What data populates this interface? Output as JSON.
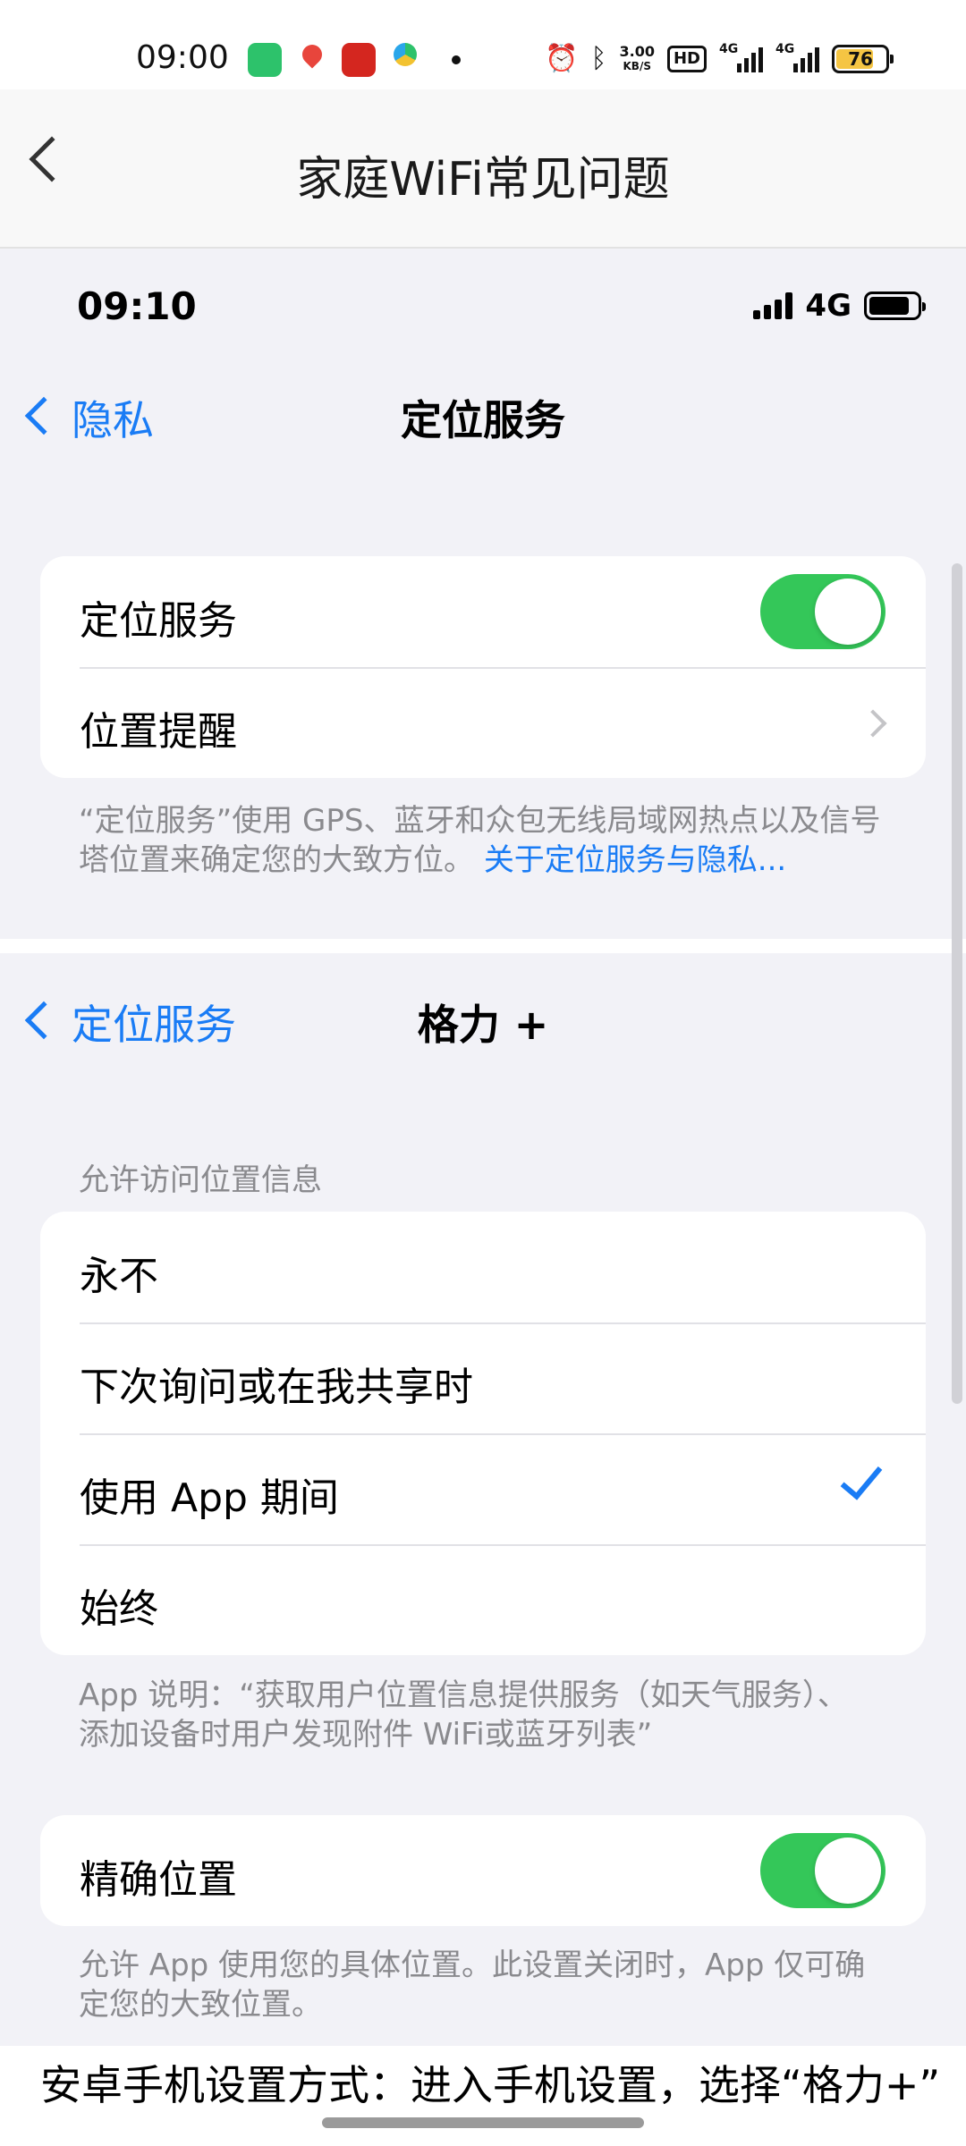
{
  "android_status": {
    "time": "09:00",
    "speed_value": "3.00",
    "speed_unit": "KB/S",
    "hd_label": "HD",
    "network_1": "4G",
    "network_2": "4G",
    "battery": "76"
  },
  "header": {
    "title": "家庭WiFi常见问题"
  },
  "ios_status": {
    "time": "09:10",
    "network": "4G"
  },
  "privacy_screen": {
    "back_label": "隐私",
    "title": "定位服务",
    "location_services_label": "定位服务",
    "location_services_on": true,
    "location_alerts_label": "位置提醒",
    "footnote_text": "“定位服务”使用 GPS、蓝牙和众包无线局域网热点以及信号塔位置来确定您的大致方位。",
    "footnote_link": "关于定位服务与隐私..."
  },
  "app_screen": {
    "back_label": "定位服务",
    "title": "格力 +",
    "section_header": "允许访问位置信息",
    "options": [
      {
        "label": "永不",
        "selected": false
      },
      {
        "label": "下次询问或在我共享时",
        "selected": false
      },
      {
        "label": "使用 App 期间",
        "selected": true
      },
      {
        "label": "始终",
        "selected": false
      }
    ],
    "app_explanation": "App 说明：“获取用户位置信息提供服务（如天气服务）、 添加设备时用户发现附件 WiFi或蓝牙列表”",
    "precise_location_label": "精确位置",
    "precise_location_on": true,
    "precise_footnote": "允许 App 使用您的具体位置。此设置关闭时，App 仅可确定您的大致位置。"
  },
  "caption": {
    "text": "安卓手机设置方式：进入手机设置，选择“格力+”"
  },
  "colors": {
    "ios_blue": "#1a7cf5",
    "toggle_green": "#34c759",
    "ios_bg": "#f2f2f7"
  }
}
